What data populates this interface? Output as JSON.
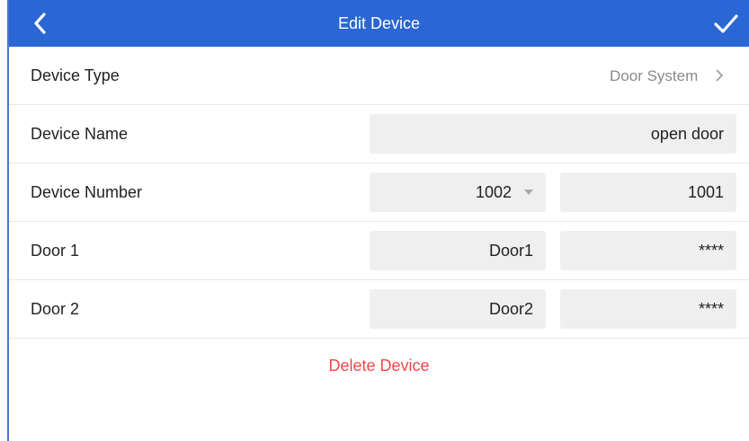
{
  "header": {
    "title": "Edit Device",
    "back_icon": "chevron-left-icon",
    "confirm_icon": "checkmark-icon"
  },
  "colors": {
    "accent": "#2a66d4",
    "danger": "#f04848",
    "field_bg": "#efefef"
  },
  "rows": {
    "device_type": {
      "label": "Device Type",
      "value": "Door System"
    },
    "device_name": {
      "label": "Device Name",
      "value": "open door"
    },
    "device_number": {
      "label": "Device Number",
      "select_value": "1002",
      "value": "1001"
    },
    "door1": {
      "label": "Door 1",
      "name": "Door1",
      "password": "****"
    },
    "door2": {
      "label": "Door 2",
      "name": "Door2",
      "password": "****"
    }
  },
  "actions": {
    "delete_label": "Delete Device"
  }
}
